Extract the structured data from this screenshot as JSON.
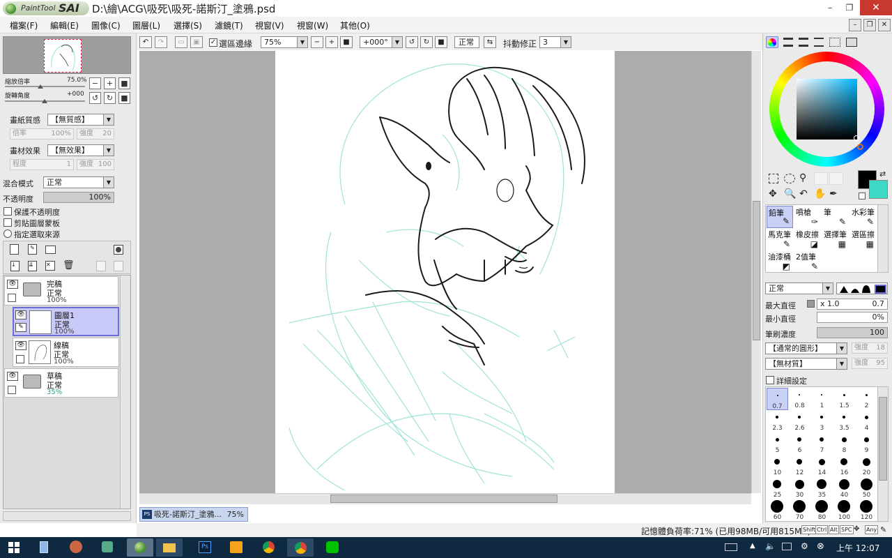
{
  "app": {
    "logo_text_small": "PaintTool",
    "logo_text_big": "SAI",
    "title": "D:\\繪\\ACG\\吸死\\吸死-諾斯汀_塗鴉.psd",
    "win_minimize": "–",
    "win_restore": "❐",
    "win_close": "✕"
  },
  "menu": [
    "檔案(F)",
    "編輯(E)",
    "圖像(C)",
    "圖層(L)",
    "選擇(S)",
    "濾鏡(T)",
    "視窗(V)",
    "視窗(W)",
    "其他(O)"
  ],
  "navigator": {
    "zoom_label": "縮放倍率",
    "zoom_value": "75.0%",
    "rotate_label": "旋轉角度",
    "rotate_value": "+000"
  },
  "paper": {
    "texture_label": "畫紙質感",
    "texture_value": "【無質感】",
    "scale_label": "倍率",
    "scale_value": "100%",
    "strength_label": "強度",
    "strength_value": "20",
    "effect_label": "畫材效果",
    "effect_value": "【無效果】",
    "degree_label": "程度",
    "degree_value": "1",
    "effect_strength_label": "強度",
    "effect_strength_value": "100"
  },
  "blend": {
    "mode_label": "混合模式",
    "mode_value": "正常",
    "opacity_label": "不透明度",
    "opacity_value": "100%",
    "options": [
      "保護不透明度",
      "剪貼圖層蒙板",
      "指定選取來源"
    ]
  },
  "layers": [
    {
      "name": "完稿",
      "mode": "正常",
      "opacity": "100%",
      "type": "folder"
    },
    {
      "name": "圖層1",
      "mode": "正常",
      "opacity": "100%",
      "type": "layer"
    },
    {
      "name": "線稿",
      "mode": "正常",
      "opacity": "100%",
      "type": "layer"
    },
    {
      "name": "草稿",
      "mode": "正常",
      "opacity": "35%",
      "type": "folder"
    }
  ],
  "toolbar": {
    "selection_edge_label": "選區邊緣",
    "zoom_value": "75%",
    "angle_value": "+000°",
    "mode_value": "正常",
    "stabilizer_label": "抖動修正",
    "stabilizer_value": "3"
  },
  "document_tab": {
    "name": "吸死-諾斯汀_塗鴉...",
    "zoom": "75%"
  },
  "status": {
    "memory": "記憶體負荷率:71% (已用98MB/可用815MB)",
    "keys": [
      "Shift",
      "Ctrl",
      "Alt",
      "SPC",
      "Any"
    ]
  },
  "tools": [
    {
      "label": "鉛筆",
      "selected": true
    },
    {
      "label": "噴槍",
      "selected": false
    },
    {
      "label": "筆",
      "selected": false
    },
    {
      "label": "水彩筆",
      "selected": false
    },
    {
      "label": "馬克筆",
      "selected": false
    },
    {
      "label": "橡皮擦",
      "selected": false
    },
    {
      "label": "選擇筆",
      "selected": false
    },
    {
      "label": "選區擦",
      "selected": false
    },
    {
      "label": "油漆桶",
      "selected": false
    },
    {
      "label": "2值筆",
      "selected": false
    }
  ],
  "brush": {
    "mode_value": "正常",
    "max_size_label": "最大直徑",
    "max_size_mult": "x 1.0",
    "max_size_value": "0.7",
    "min_size_label": "最小直徑",
    "min_size_value": "0%",
    "density_label": "筆刷濃度",
    "density_value": "100",
    "shape_value": "【通常的圓形】",
    "shape_strength_label": "強度",
    "shape_strength_value": "18",
    "texture_value": "【無材質】",
    "texture_strength_label": "強度",
    "texture_strength_value": "95",
    "advanced_label": "詳細設定",
    "sizes": [
      "0.7",
      "0.8",
      "1",
      "1.5",
      "2",
      "2.3",
      "2.6",
      "3",
      "3.5",
      "4",
      "5",
      "6",
      "7",
      "8",
      "9",
      "10",
      "12",
      "14",
      "16",
      "20",
      "25",
      "30",
      "35",
      "40",
      "50",
      "60",
      "70",
      "80",
      "100",
      "120"
    ]
  },
  "colors": {
    "foreground": "#000000",
    "background": "#3fd8c4",
    "sketch_line": "#9fe3d8",
    "selected_layer_bg": "#c9c9f7"
  },
  "taskbar": {
    "clock": "上午 12:07"
  }
}
